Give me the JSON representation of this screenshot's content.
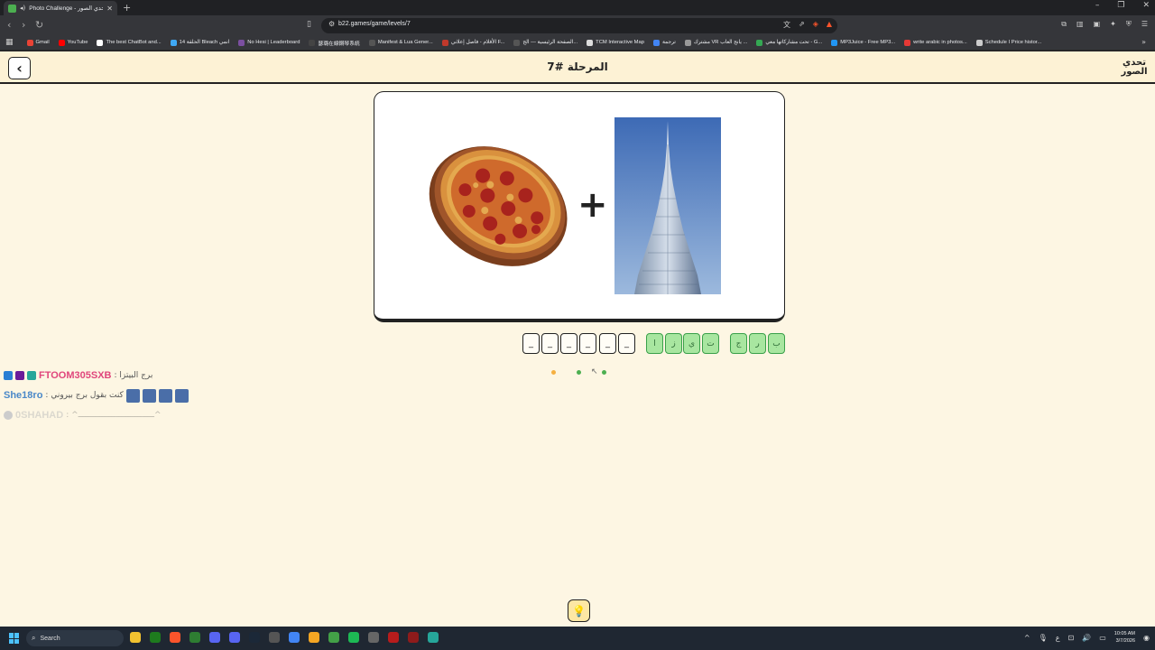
{
  "browser": {
    "tab_title": "Photo Challenge - لعبة تحدي الصور",
    "url": "b22.games/game/levels/7",
    "bookmarks": [
      {
        "label": "Gmail",
        "color": "#ea4335"
      },
      {
        "label": "YouTube",
        "color": "#ff0000"
      },
      {
        "label": "The best ChatBot and...",
        "color": "#ffffff"
      },
      {
        "label": "الحلقة 14 Bleach انمي",
        "color": "#3fa9f5"
      },
      {
        "label": "No Hesi | Leaderboard",
        "color": "#7b4fa0"
      },
      {
        "label": "瑟璐在線鋼琴系統",
        "color": "#444444"
      },
      {
        "label": "Manifest & Lua Gener...",
        "color": "#555555"
      },
      {
        "label": "الأفلام - فاصل إعلاني F...",
        "color": "#c0392b"
      },
      {
        "label": "الصفحة الرئيسية — الج...",
        "color": "#555555"
      },
      {
        "label": "TCM Interactive Map",
        "color": "#dddddd"
      },
      {
        "label": "ترجمة",
        "color": "#4285f4"
      },
      {
        "label": "مشترك VR يانج العاب ...",
        "color": "#999999"
      },
      {
        "label": "تحت مشاركاتها معي - G...",
        "color": "#34a853"
      },
      {
        "label": "MP3Juice - Free MP3...",
        "color": "#2196f3"
      },
      {
        "label": "write arabic in photos...",
        "color": "#e53935"
      },
      {
        "label": "Schedule I Price histor...",
        "color": "#cccccc"
      }
    ]
  },
  "page": {
    "back_icon": "chevron-left-icon",
    "level_title": "المرحلة #7",
    "logo_top": "تحدي",
    "logo_bottom": "الصور",
    "clue_left": "pizza",
    "clue_operator": "+",
    "clue_right": "burj-khalifa-tower",
    "answer_slots": [
      "_",
      "_",
      "_",
      "_",
      "_",
      "_"
    ],
    "letter_group_1": [
      "ا",
      "ز",
      "ي",
      "ت"
    ],
    "letter_group_2": [
      "ج",
      "ر",
      "ب"
    ],
    "progress_dots": [
      {
        "state": "current",
        "color": "#f5b041"
      },
      {
        "state": "done",
        "color": "#4caf50"
      },
      {
        "state": "done",
        "color": "#4caf50"
      }
    ],
    "hint_icon": "lightbulb-icon"
  },
  "chat": [
    {
      "user": "FTOOM305SXB",
      "message": ": برج البيتزا",
      "user_color": "#e0457b",
      "badges": [
        "#2a7fd4",
        "#6a1b9a",
        "#26a69a"
      ]
    },
    {
      "user": "She18ro",
      "message": ": كنت بقول برج بيروني",
      "user_color": "#4a88c8",
      "emotes": 4
    },
    {
      "user": "0SHAHAD",
      "message": ": ^ــــــــــــــــــــــــــــــــ^",
      "user_color": "#bbbbbb"
    }
  ],
  "taskbar": {
    "search_label": "Search",
    "time": "10:05 AM",
    "date": "3/7/2026",
    "lang": "ع"
  }
}
